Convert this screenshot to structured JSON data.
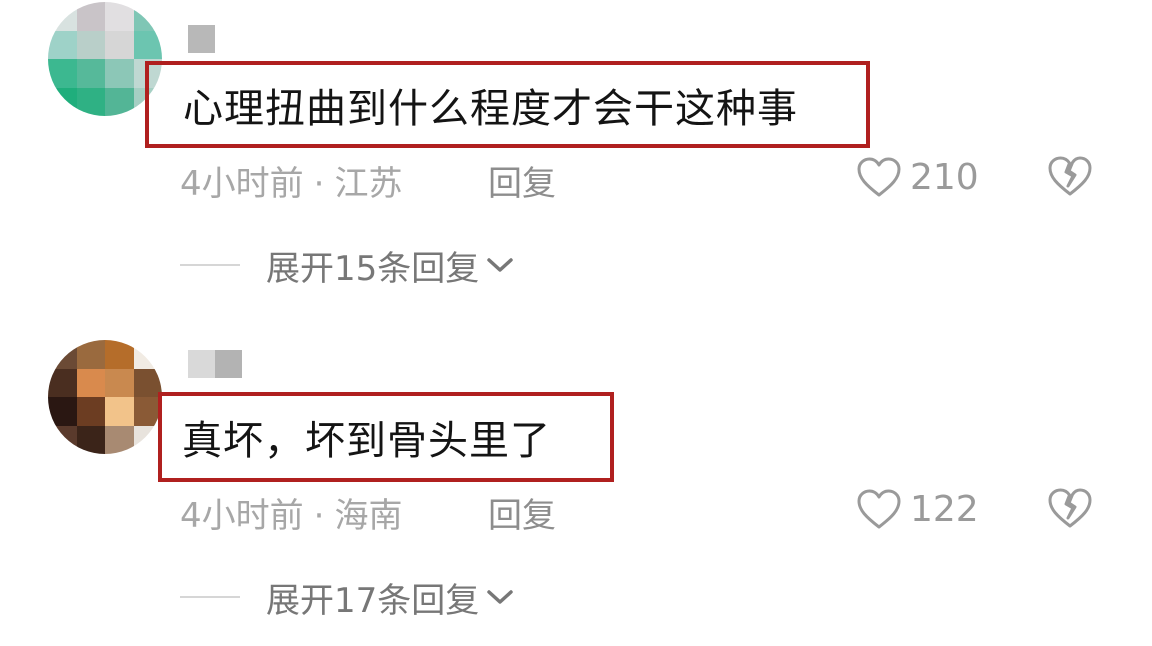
{
  "comments": [
    {
      "content": "心理扭曲到什么程度才会干这种事",
      "time": "4小时前",
      "separator": "·",
      "location": "江苏",
      "reply_label": "回复",
      "likes": "210",
      "expand_label": "展开15条回复",
      "avatar_colors": [
        "#d8e2e0",
        "#c9c4c8",
        "#e1dfe1",
        "#7fc6b5",
        "#9ed2c8",
        "#b9cfc9",
        "#d6d6d6",
        "#6cc5b0",
        "#3cb890",
        "#56b99a",
        "#8cc7b7",
        "#bfd8d2",
        "#1fae7c",
        "#2fb184",
        "#53b596",
        "#a5cfc3"
      ],
      "username_colors": [
        "#b8b8b8"
      ]
    },
    {
      "content": "真坏，坏到骨头里了",
      "time": "4小时前",
      "separator": "·",
      "location": "海南",
      "reply_label": "回复",
      "likes": "122",
      "expand_label": "展开17条回复",
      "avatar_colors": [
        "#6b4a35",
        "#9a6a3e",
        "#b56d2a",
        "#f1ebe3",
        "#4a2e20",
        "#d98a4d",
        "#c9894f",
        "#7a5030",
        "#2a1712",
        "#6c3d22",
        "#f2c38a",
        "#8a5a36",
        "#5a3a2c",
        "#3b2419",
        "#a88a72",
        "#e8e3dd"
      ],
      "username_colors": [
        "#d9d9d9",
        "#b3b3b3"
      ]
    }
  ],
  "colors": {
    "highlight_border": "#b0201f",
    "meta_text": "#a7a7a7",
    "icon_gray": "#9a9a9a"
  },
  "icons": [
    "heart-icon",
    "broken-heart-icon",
    "chevron-down-icon"
  ]
}
